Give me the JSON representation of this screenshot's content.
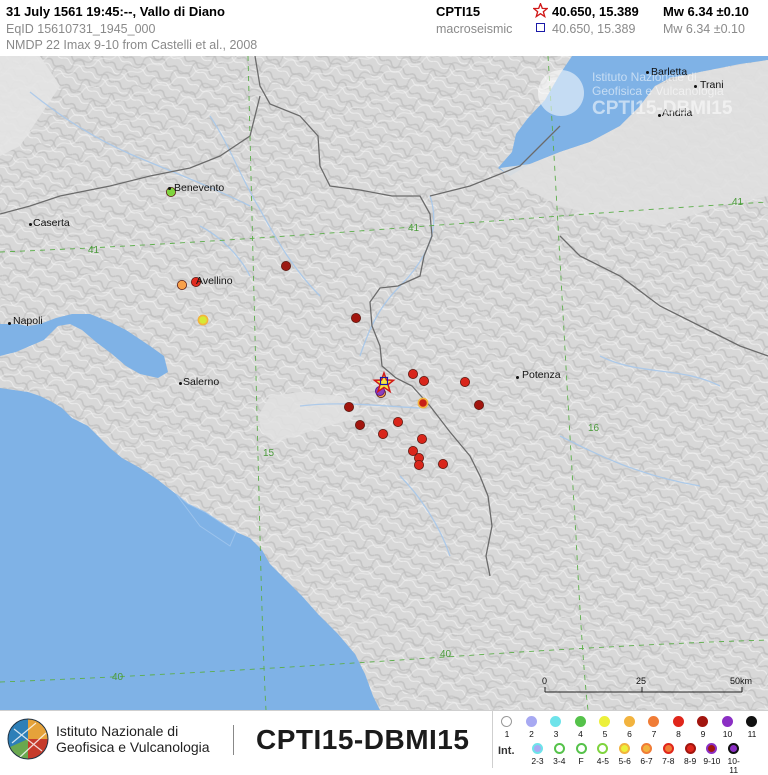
{
  "header": {
    "title": "31 July 1561  19:45:--,  Vallo di Diano",
    "eqid": "EqID 15610731_1945_000",
    "nmdp": "NMDP  22   Imax 9-10   from Castelli et al., 2008",
    "catalogue": "CPTI15",
    "macroseismic": "macroseismic",
    "epicenter_coords": "40.650, 15.389",
    "macro_coords": "40.650, 15.389",
    "mw": "Mw 6.34 ±0.10",
    "mw_macro": "Mw 6.34 ±0.10",
    "star_color": "#d01818",
    "square_color": "#1a1aa8"
  },
  "map": {
    "places": [
      {
        "name": "Benevento"
      },
      {
        "name": "Caserta"
      },
      {
        "name": "Avellino"
      },
      {
        "name": "Napoli"
      },
      {
        "name": "Salerno"
      },
      {
        "name": "Potenza"
      },
      {
        "name": "Barletta"
      },
      {
        "name": "Trani"
      },
      {
        "name": "Andria"
      }
    ],
    "grid_labels": [
      "41",
      "41",
      "41",
      "16",
      "15",
      "40",
      "40"
    ],
    "watermark": {
      "line1": "Istituto Nazionale di",
      "line2": "Geofisica e Vulcanologia",
      "line3": "CPTI15-DBMI15"
    },
    "scale": {
      "labels": [
        "0",
        "25",
        "50km"
      ]
    },
    "intensity_points": [
      {
        "intensity": "6",
        "color": "#7fd43e"
      },
      {
        "intensity": "7",
        "color": "#f7a04a"
      },
      {
        "intensity": "8",
        "color": "#e12a1e"
      },
      {
        "intensity": "5-6",
        "color": "#d6e935"
      },
      {
        "intensity": "9",
        "color": "#9c1a12"
      },
      {
        "intensity": "8",
        "color": "#d9261b"
      },
      {
        "intensity": "9",
        "color": "#a2150e"
      },
      {
        "intensity": "9",
        "color": "#a2150e"
      },
      {
        "intensity": "9",
        "color": "#a2150e"
      },
      {
        "intensity": "7",
        "color": "#f7a04a"
      },
      {
        "intensity": "8",
        "color": "#d9261b"
      },
      {
        "intensity": "8",
        "color": "#d9261b"
      },
      {
        "intensity": "8-9",
        "color": "#c81f16"
      },
      {
        "intensity": "9-10",
        "color": "#8b3fbf"
      },
      {
        "intensity": "8",
        "color": "#d9261b"
      },
      {
        "intensity": "8",
        "color": "#d9261b"
      },
      {
        "intensity": "9",
        "color": "#a2150e"
      },
      {
        "intensity": "8",
        "color": "#d9261b"
      },
      {
        "intensity": "8",
        "color": "#d9261b"
      },
      {
        "intensity": "8",
        "color": "#d9261b"
      },
      {
        "intensity": "8",
        "color": "#d9261b"
      },
      {
        "intensity": "8",
        "color": "#d9261b"
      }
    ],
    "colors": {
      "sea": "#7fb2e6",
      "land": "#d6d6d6",
      "border": "#6b6b6b",
      "grid": "#5cae4a",
      "river": "#a8c8ea"
    }
  },
  "footer": {
    "institute_line1": "Istituto Nazionale di",
    "institute_line2": "Geofisica e Vulcanologia",
    "database": "CPTI15-DBMI15"
  },
  "legend": {
    "label": "Int.",
    "row1": [
      {
        "label": "1",
        "color": "#ffffff"
      },
      {
        "label": "2",
        "color": "#a7a9f2"
      },
      {
        "label": "3",
        "color": "#6ee3ea"
      },
      {
        "label": "4",
        "color": "#55c24a"
      },
      {
        "label": "5",
        "color": "#ecf03a"
      },
      {
        "label": "6",
        "color": "#f2b33e"
      },
      {
        "label": "7",
        "color": "#f07c36"
      },
      {
        "label": "8",
        "color": "#e0261b"
      },
      {
        "label": "9",
        "color": "#a2150e"
      },
      {
        "label": "10",
        "color": "#8b2fc4"
      },
      {
        "label": "11",
        "color": "#111111"
      }
    ],
    "row2": [
      {
        "label": "2-3",
        "fill": "#a7a9f2",
        "ring": "#6ee3ea"
      },
      {
        "label": "3-4",
        "fill": "#ffffff",
        "ring": "#55c24a"
      },
      {
        "label": "F",
        "fill": "#ffffff",
        "ring": "#55c24a"
      },
      {
        "label": "4-5",
        "fill": "#ffffff",
        "ring": "#7fd43e"
      },
      {
        "label": "5-6",
        "fill": "#ecf03a",
        "ring": "#f2b33e"
      },
      {
        "label": "6-7",
        "fill": "#f2b33e",
        "ring": "#f07c36"
      },
      {
        "label": "7-8",
        "fill": "#f07c36",
        "ring": "#e0261b"
      },
      {
        "label": "8-9",
        "fill": "#e0261b",
        "ring": "#a2150e"
      },
      {
        "label": "9-10",
        "fill": "#a2150e",
        "ring": "#8b2fc4"
      },
      {
        "label": "10-11",
        "fill": "#8b2fc4",
        "ring": "#111111"
      }
    ]
  }
}
